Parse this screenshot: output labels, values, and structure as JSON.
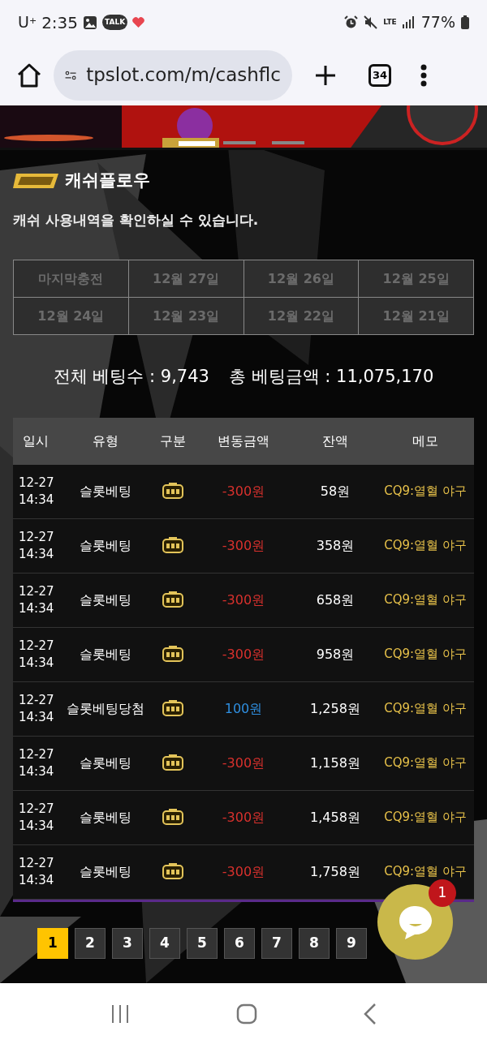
{
  "status_bar": {
    "carrier": "U",
    "carrier_sup": "+",
    "time": "2:35",
    "talk": "TALK",
    "network": "LTE",
    "battery": "77%"
  },
  "browser": {
    "url": "tpslot.com/m/cashflc",
    "tabs": "34"
  },
  "page": {
    "title": "캐쉬플로우",
    "subtitle": "캐쉬 사용내역을 확인하실 수 있습니다."
  },
  "date_tabs": [
    {
      "label": "마지막충전",
      "selected": false
    },
    {
      "label": "12월 27일",
      "selected": false
    },
    {
      "label": "12월 26일",
      "selected": false
    },
    {
      "label": "12월 25일",
      "selected": false
    },
    {
      "label": "12월 24일",
      "selected": false
    },
    {
      "label": "12월 23일",
      "selected": false
    },
    {
      "label": "12월 22일",
      "selected": false
    },
    {
      "label": "12월 21일",
      "selected": false
    }
  ],
  "summary": {
    "count_label": "전체 베팅수 : 9,743",
    "amount_label": "총 베팅금액 : 11,075,170"
  },
  "table": {
    "columns": [
      "일시",
      "유형",
      "구분",
      "변동금액",
      "잔액",
      "메모"
    ],
    "rows": [
      {
        "date": "12-27",
        "time": "14:34",
        "type": "슬롯베팅",
        "kind": "debit",
        "change": "-300원",
        "balance": "58원",
        "memo": "CQ9:열혈 야구"
      },
      {
        "date": "12-27",
        "time": "14:34",
        "type": "슬롯베팅",
        "kind": "debit",
        "change": "-300원",
        "balance": "358원",
        "memo": "CQ9:열혈 야구"
      },
      {
        "date": "12-27",
        "time": "14:34",
        "type": "슬롯베팅",
        "kind": "debit",
        "change": "-300원",
        "balance": "658원",
        "memo": "CQ9:열혈 야구"
      },
      {
        "date": "12-27",
        "time": "14:34",
        "type": "슬롯베팅",
        "kind": "debit",
        "change": "-300원",
        "balance": "958원",
        "memo": "CQ9:열혈 야구"
      },
      {
        "date": "12-27",
        "time": "14:34",
        "type": "슬롯베팅당첨",
        "kind": "credit",
        "change": "100원",
        "balance": "1,258원",
        "memo": "CQ9:열혈 야구"
      },
      {
        "date": "12-27",
        "time": "14:34",
        "type": "슬롯베팅",
        "kind": "debit",
        "change": "-300원",
        "balance": "1,158원",
        "memo": "CQ9:열혈 야구"
      },
      {
        "date": "12-27",
        "time": "14:34",
        "type": "슬롯베팅",
        "kind": "debit",
        "change": "-300원",
        "balance": "1,458원",
        "memo": "CQ9:열혈 야구"
      },
      {
        "date": "12-27",
        "time": "14:34",
        "type": "슬롯베팅",
        "kind": "debit",
        "change": "-300원",
        "balance": "1,758원",
        "memo": "CQ9:열혈 야구"
      }
    ]
  },
  "pagination": [
    {
      "label": "1",
      "selected": true
    },
    {
      "label": "2",
      "selected": false
    },
    {
      "label": "3",
      "selected": false
    },
    {
      "label": "4",
      "selected": false
    },
    {
      "label": "5",
      "selected": false
    },
    {
      "label": "6",
      "selected": false
    },
    {
      "label": "7",
      "selected": false
    },
    {
      "label": "8",
      "selected": false
    },
    {
      "label": "9",
      "selected": false
    }
  ],
  "chat": {
    "badge": "1"
  }
}
